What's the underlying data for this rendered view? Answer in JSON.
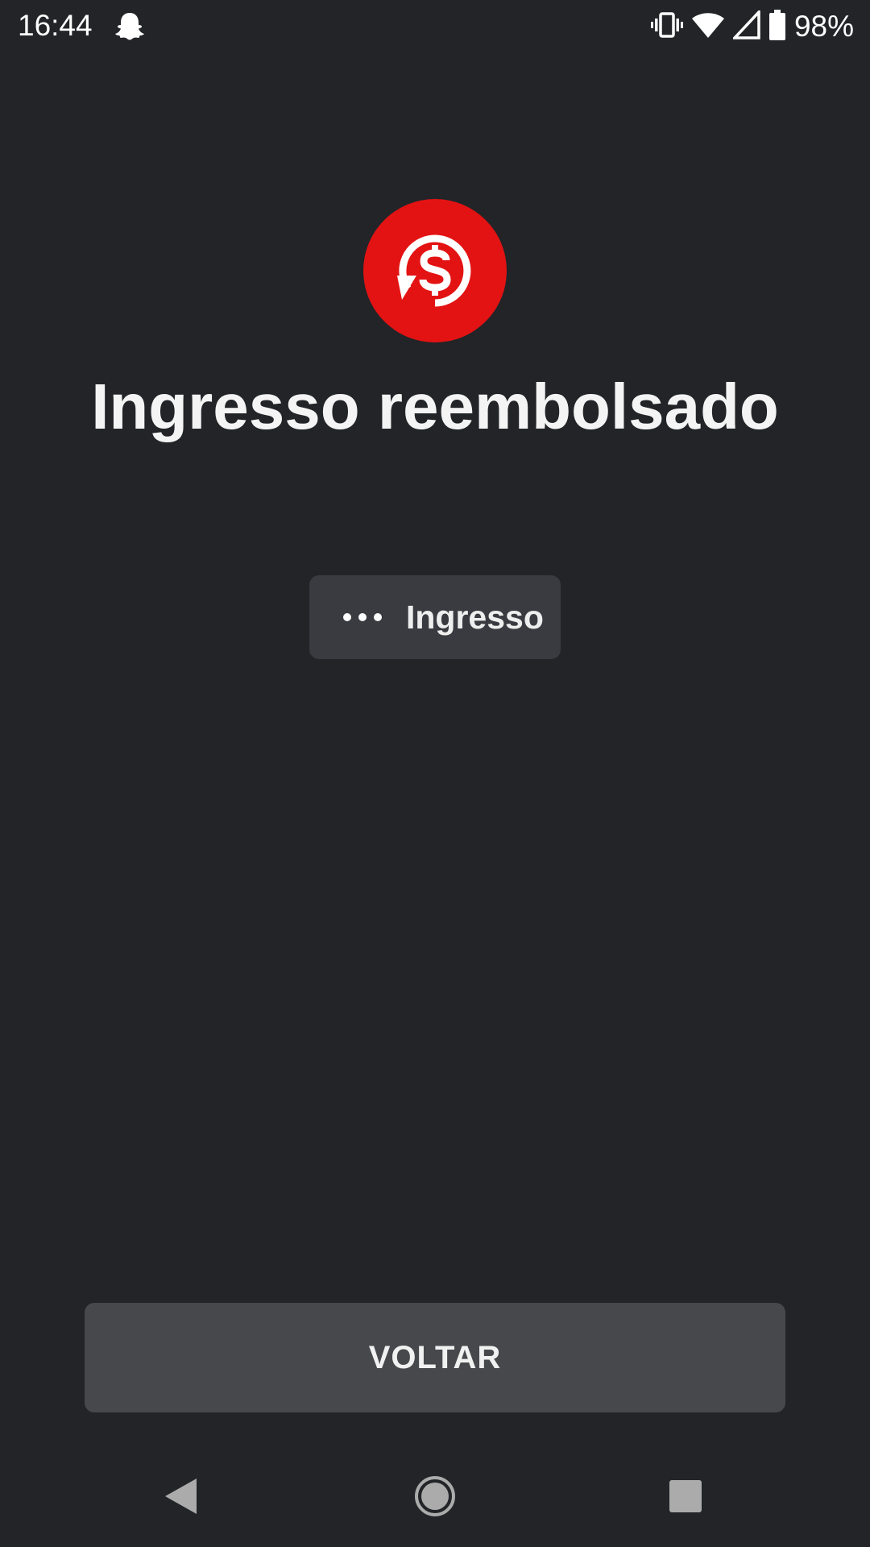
{
  "status_bar": {
    "time": "16:44",
    "left_icons": [
      "snapchat-ghost-icon"
    ],
    "right_icons": [
      "vibrate-icon",
      "wifi-icon",
      "cell-signal-icon",
      "battery-icon"
    ],
    "battery_percent": "98%"
  },
  "hero": {
    "icon": "refund-dollar-icon",
    "icon_color": "#e31313",
    "title": "Ingresso reembolsado"
  },
  "chip": {
    "icon": "more-dots-icon",
    "label": "Ingresso"
  },
  "footer": {
    "back_button_label": "VOLTAR"
  },
  "navigation": {
    "buttons": [
      "back-icon",
      "home-icon",
      "recents-icon"
    ]
  },
  "colors": {
    "background": "#222428",
    "accent": "#e31313",
    "chip_background": "#393b40",
    "button_background": "#46484c"
  }
}
